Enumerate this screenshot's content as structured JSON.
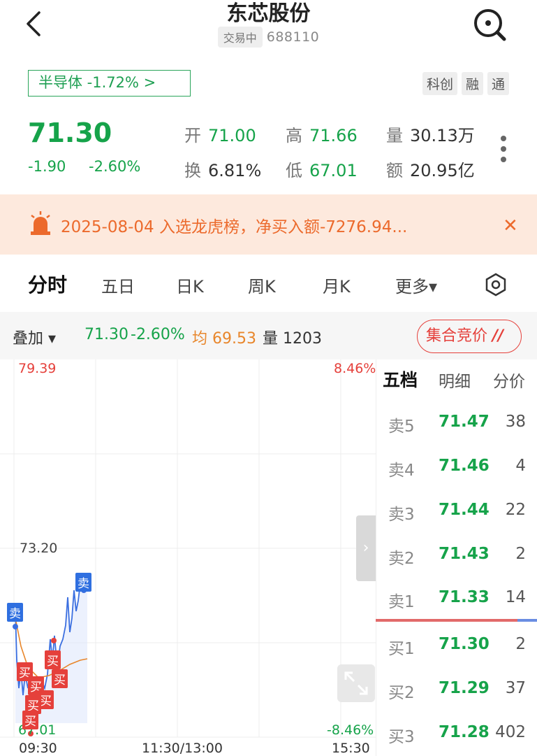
{
  "header": {
    "title": "东芯股份",
    "status_badge": "交易中",
    "code": "688110"
  },
  "sector": {
    "label": "半导体 -1.72% >"
  },
  "tags": [
    "科创",
    "融",
    "通"
  ],
  "quote": {
    "price": "71.30",
    "change": "-1.90",
    "change_pct": "-2.60%",
    "open_label": "开",
    "open": "71.00",
    "high_label": "高",
    "high": "71.66",
    "volume_label": "量",
    "volume": "30.13万",
    "turnover_label": "换",
    "turnover": "6.81%",
    "low_label": "低",
    "low": "67.01",
    "amount_label": "额",
    "amount": "20.95亿"
  },
  "notice": {
    "text": "2025-08-04 入选龙虎榜，净买入额-7276.94..."
  },
  "tabs": [
    {
      "label": "分时"
    },
    {
      "label": "五日"
    },
    {
      "label": "日K"
    },
    {
      "label": "周K"
    },
    {
      "label": "月K"
    },
    {
      "label": "更多▾"
    }
  ],
  "metrics": {
    "overlay": "叠加 ▾",
    "price": "71.30",
    "pct": "-2.60%",
    "avg": "均 69.53",
    "vol": "量 1203",
    "auction": "集合竞价"
  },
  "chart": {
    "y_top": "79.39",
    "y_mid": "73.20",
    "y_bottom": "67.01",
    "pct_top": "8.46%",
    "pct_bottom": "-8.46%",
    "x_labels": [
      "09:30",
      "11:30/13:00",
      "15:30"
    ],
    "markers": {
      "buy": "买",
      "sell": "卖"
    }
  },
  "order_book": {
    "tabs": [
      "五档",
      "明细",
      "分价"
    ],
    "sells": [
      {
        "label": "卖5",
        "price": "71.47",
        "vol": "38"
      },
      {
        "label": "卖4",
        "price": "71.46",
        "vol": "4"
      },
      {
        "label": "卖3",
        "price": "71.44",
        "vol": "22"
      },
      {
        "label": "卖2",
        "price": "71.43",
        "vol": "2"
      },
      {
        "label": "卖1",
        "price": "71.33",
        "vol": "14"
      }
    ],
    "buys": [
      {
        "label": "买1",
        "price": "71.30",
        "vol": "2"
      },
      {
        "label": "买2",
        "price": "71.29",
        "vol": "37"
      },
      {
        "label": "买3",
        "price": "71.28",
        "vol": "402"
      }
    ]
  },
  "colors": {
    "down": "#16a34a",
    "up": "#e5403b",
    "avg": "#e8862b",
    "price_line": "#3b6fe0"
  }
}
